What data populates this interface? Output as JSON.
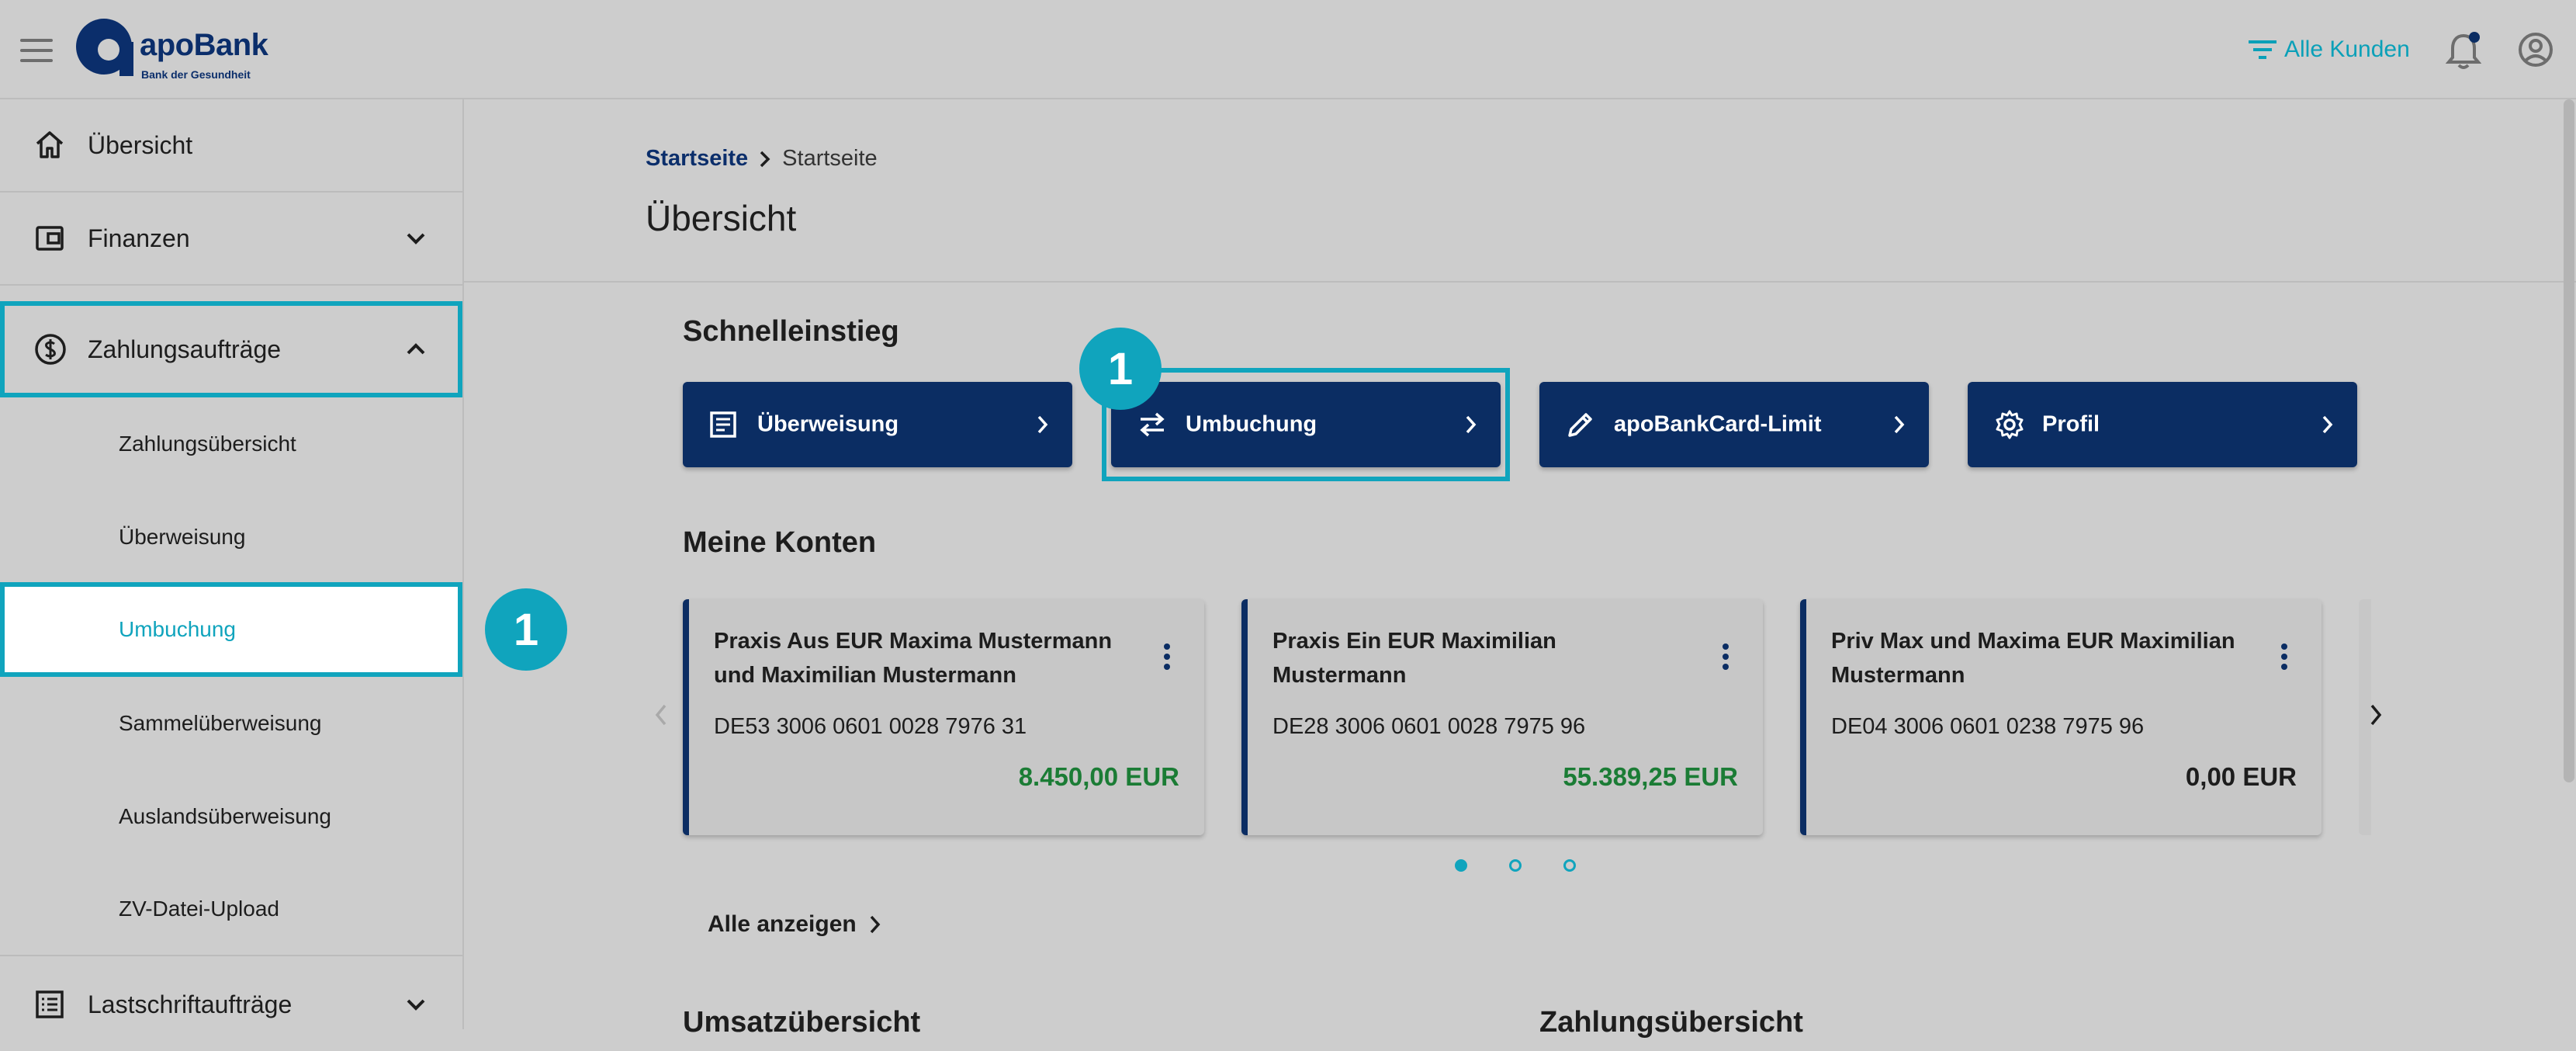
{
  "header": {
    "logo_text": "apoBank",
    "logo_subtitle": "Bank der Gesundheit",
    "filter_label": "Alle Kunden"
  },
  "sidebar": {
    "items": [
      {
        "label": "Übersicht"
      },
      {
        "label": "Finanzen"
      },
      {
        "label": "Zahlungsaufträge"
      },
      {
        "label": "Lastschriftaufträge"
      }
    ],
    "subitems": [
      {
        "label": "Zahlungsübersicht"
      },
      {
        "label": "Überweisung"
      },
      {
        "label": "Umbuchung"
      },
      {
        "label": "Sammelüberweisung"
      },
      {
        "label": "Auslandsüberweisung"
      },
      {
        "label": "ZV-Datei-Upload"
      }
    ]
  },
  "breadcrumb": {
    "home": "Startseite",
    "current": "Startseite"
  },
  "page_title": "Übersicht",
  "quick": {
    "title": "Schnelleinstieg",
    "buttons": [
      {
        "label": "Überweisung"
      },
      {
        "label": "Umbuchung"
      },
      {
        "label": "apoBankCard-Limit"
      },
      {
        "label": "Profil"
      }
    ]
  },
  "badges": {
    "one": "1",
    "two": "1"
  },
  "accounts": {
    "title": "Meine Konten",
    "cards": [
      {
        "name": "Praxis Aus EUR Maxima Mustermann und Maximilian Mustermann",
        "iban": "DE53 3006 0601 0028 7976 31",
        "balance": "8.450,00 EUR"
      },
      {
        "name": "Praxis Ein EUR Maximilian Mustermann",
        "iban": "DE28 3006 0601 0028 7975 96",
        "balance": "55.389,25 EUR"
      },
      {
        "name": "Priv Max und Maxima EUR Maximilian Mustermann",
        "iban": "DE04 3006 0601 0238 7975 96",
        "balance": "0,00 EUR"
      }
    ],
    "show_all": "Alle anzeigen"
  },
  "bottom": {
    "left_title": "Umsatzübersicht",
    "right_title": "Zahlungsübersicht"
  },
  "colors": {
    "accent": "#10a4bd",
    "navy": "#0b2d63",
    "positive": "#1b7c35"
  }
}
